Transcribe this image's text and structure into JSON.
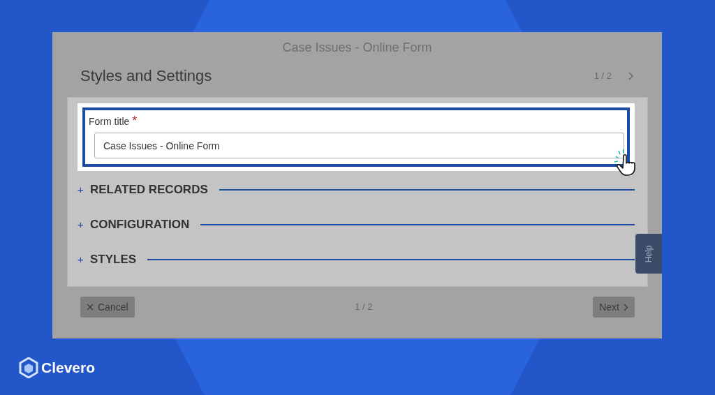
{
  "modal": {
    "title": "Case Issues - Online Form",
    "heading": "Styles and Settings",
    "pager": "1 / 2",
    "field": {
      "label": "Form title",
      "required_mark": "*",
      "value": "Case Issues - Online Form",
      "highlighted": true
    },
    "sections": [
      {
        "toggle": "+",
        "label": "RELATED RECORDS"
      },
      {
        "toggle": "+",
        "label": "CONFIGURATION"
      },
      {
        "toggle": "+",
        "label": "STYLES"
      }
    ],
    "footer": {
      "cancel": "Cancel",
      "pager": "1 / 2",
      "next": "Next"
    },
    "help_tab": "Help"
  },
  "brand": "Clevero"
}
